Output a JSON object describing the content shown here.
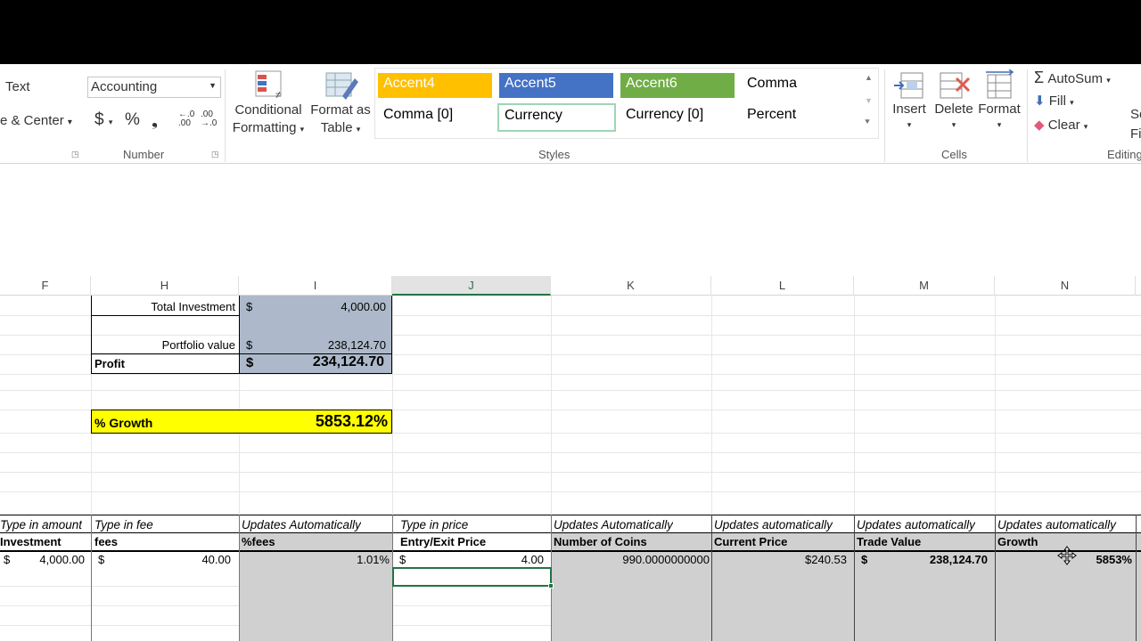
{
  "ribbon": {
    "alignment": {
      "wrap_text": "Text",
      "merge_center": "e & Center"
    },
    "number": {
      "format_value": "Accounting",
      "currency_symbol": "$",
      "percent_symbol": "%",
      "comma_symbol": "❟",
      "group_label": "Number"
    },
    "styles": {
      "conditional_formatting": [
        "Conditional",
        "Formatting"
      ],
      "format_as_table": [
        "Format as",
        "Table"
      ],
      "cells": [
        "Accent4",
        "Accent5",
        "Accent6",
        "Comma",
        "Comma [0]",
        "Currency",
        "Currency [0]",
        "Percent"
      ],
      "group_label": "Styles",
      "accent4_color": "#FFC000",
      "accent5_color": "#4472C4",
      "accent6_color": "#70AD47"
    },
    "cells_group": {
      "insert": "Insert",
      "delete": "Delete",
      "format": "Format",
      "group_label": "Cells"
    },
    "editing": {
      "autosum": "AutoSum",
      "fill": "Fill",
      "clear": "Clear",
      "sort_partial": "So",
      "find_partial": "Fi",
      "group_label": "Editing"
    }
  },
  "columns": [
    "F",
    "H",
    "I",
    "J",
    "K",
    "L",
    "M",
    "N"
  ],
  "summary": {
    "total_investment_label": "Total Investment",
    "total_investment_currency": "$",
    "total_investment_value": "4,000.00",
    "portfolio_label": "Portfolio value",
    "portfolio_currency": "$",
    "portfolio_value": "238,124.70",
    "profit_label": "Profit",
    "profit_currency": "$",
    "profit_value": "234,124.70",
    "growth_label": "% Growth",
    "growth_value": "5853.12%"
  },
  "table": {
    "hints": [
      "Type in amount",
      "Type in fee",
      "Updates Automatically",
      "Type in price",
      "Updates Automatically",
      "Updates automatically",
      "Updates automatically",
      "Updates automatically"
    ],
    "headers": [
      "Investment",
      "fees",
      "%fees",
      "Entry/Exit Price",
      "Number of Coins",
      "Current Price",
      "Trade Value",
      "Growth"
    ],
    "row": {
      "investment_currency": "$",
      "investment": "4,000.00",
      "fees_currency": "$",
      "fees": "40.00",
      "pct_fees": "1.01%",
      "price_currency": "$",
      "price": "4.00",
      "coins": "990.0000000000",
      "current_price": "$240.53",
      "trade_currency": "$",
      "trade_value": "238,124.70",
      "growth": "5853%"
    }
  }
}
